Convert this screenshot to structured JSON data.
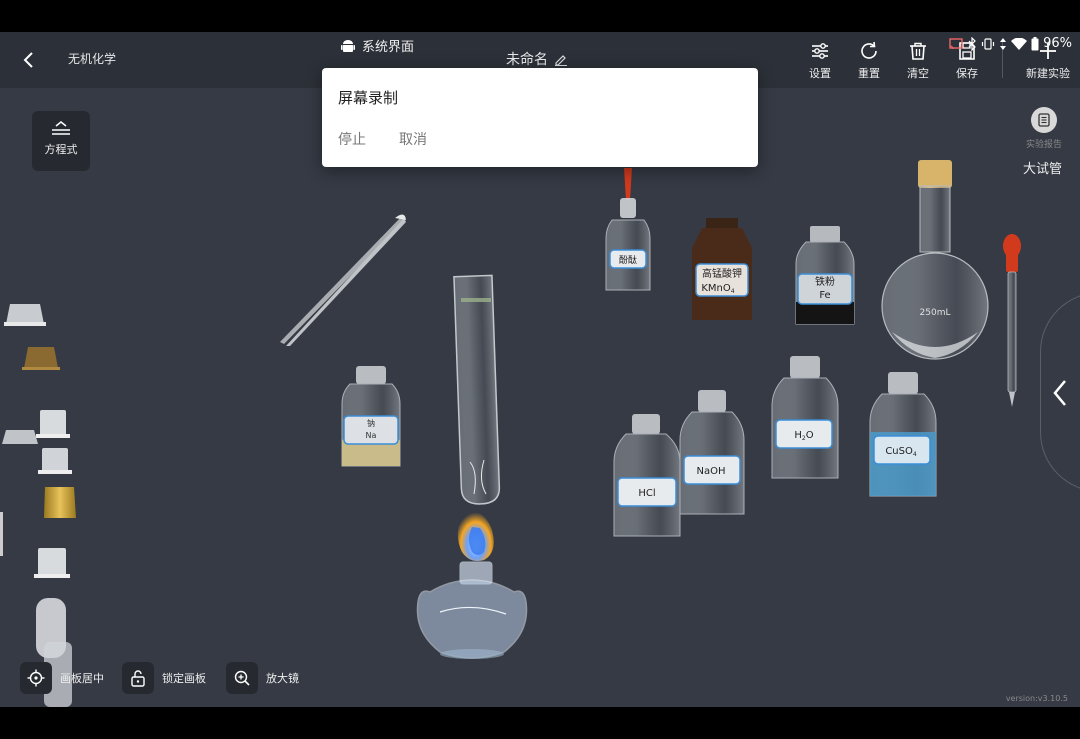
{
  "app": {
    "title": "无机化学",
    "system_label": "系统界面",
    "doc_name": "未命名"
  },
  "toolbar": {
    "settings": "设置",
    "reset": "重置",
    "clear": "清空",
    "save": "保存",
    "new_experiment": "新建实验"
  },
  "status": {
    "battery": "96%"
  },
  "side": {
    "equation": "方程式",
    "report": "实验报告",
    "current_tool": "大试管"
  },
  "dialog": {
    "title": "屏幕录制",
    "stop": "停止",
    "cancel": "取消"
  },
  "bottom": {
    "center": "画板居中",
    "lock": "锁定画板",
    "magnifier": "放大镜"
  },
  "version": "version:v3.10.5",
  "reagents": {
    "phenolphthalein": "酚酞",
    "kmno4_name": "高锰酸钾",
    "kmno4_formula": "KMnO",
    "kmno4_sub": "4",
    "iron_name": "铁粉",
    "iron_formula": "Fe",
    "flask_volume": "250mL",
    "sodium_name": "钠",
    "sodium_formula": "Na",
    "hcl": "HCl",
    "naoh": "NaOH",
    "h2o_a": "H",
    "h2o_sub": "2",
    "h2o_b": "O",
    "cuso4_a": "CuSO",
    "cuso4_sub": "4"
  },
  "colors": {
    "background": "#353a44",
    "topbar": "#2c3038",
    "label_border": "#3b8ed8",
    "cuso4": "#4a9ac8",
    "kmno4": "#4a2a18",
    "flame": "#f5a623"
  }
}
